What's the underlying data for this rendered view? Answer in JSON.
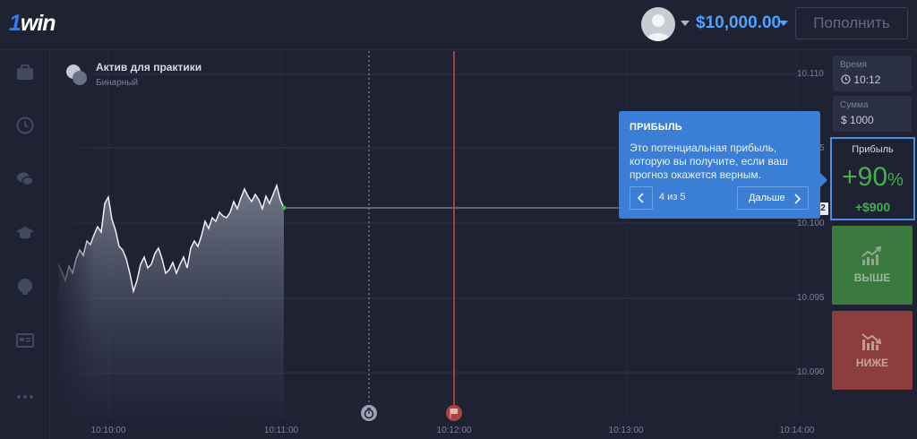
{
  "header": {
    "logo_prefix": "1",
    "logo_suffix": "win",
    "balance": "$10,000.00",
    "deposit_label": "Пополнить"
  },
  "asset": {
    "name": "Актив для практики",
    "type": "Бинарный"
  },
  "tooltip": {
    "title": "ПРИБЫЛЬ",
    "text": "Это потенциальная прибыль, которую вы получите, если ваш прогноз окажется верным.",
    "step": "4 из 5",
    "next_label": "Дальше"
  },
  "axis": {
    "y_labels": [
      "10.110",
      "5",
      "10.100",
      "10.095",
      "10.090"
    ],
    "x_labels": [
      "10:10:00",
      "10:11:00",
      "10:12:00",
      "10:13:00",
      "10:14:00"
    ],
    "price_marker": "2"
  },
  "panel": {
    "time_label": "Время",
    "time_value": "10:12",
    "amount_label": "Сумма",
    "amount_value": "1000",
    "amount_currency": "$",
    "profit_label": "Прибыль",
    "profit_percent": "+90",
    "profit_percent_sign": "%",
    "profit_amount": "+$900",
    "up_label": "ВЫШЕ",
    "down_label": "НИЖЕ"
  },
  "colors": {
    "background": "#1e2233",
    "accent_blue": "#3b7ed6",
    "balance_blue": "#4da2ff",
    "profit_green": "#43b04c",
    "up_green": "#3a7a3e",
    "down_red": "#8c3e3c",
    "expiry_line": "#c0504d"
  },
  "icons": {
    "sidebar": [
      "briefcase-icon",
      "history-icon",
      "chat-icon",
      "education-icon",
      "support-icon",
      "news-icon",
      "more-icon"
    ],
    "markers": [
      "timer-icon",
      "finish-flag-icon"
    ]
  }
}
